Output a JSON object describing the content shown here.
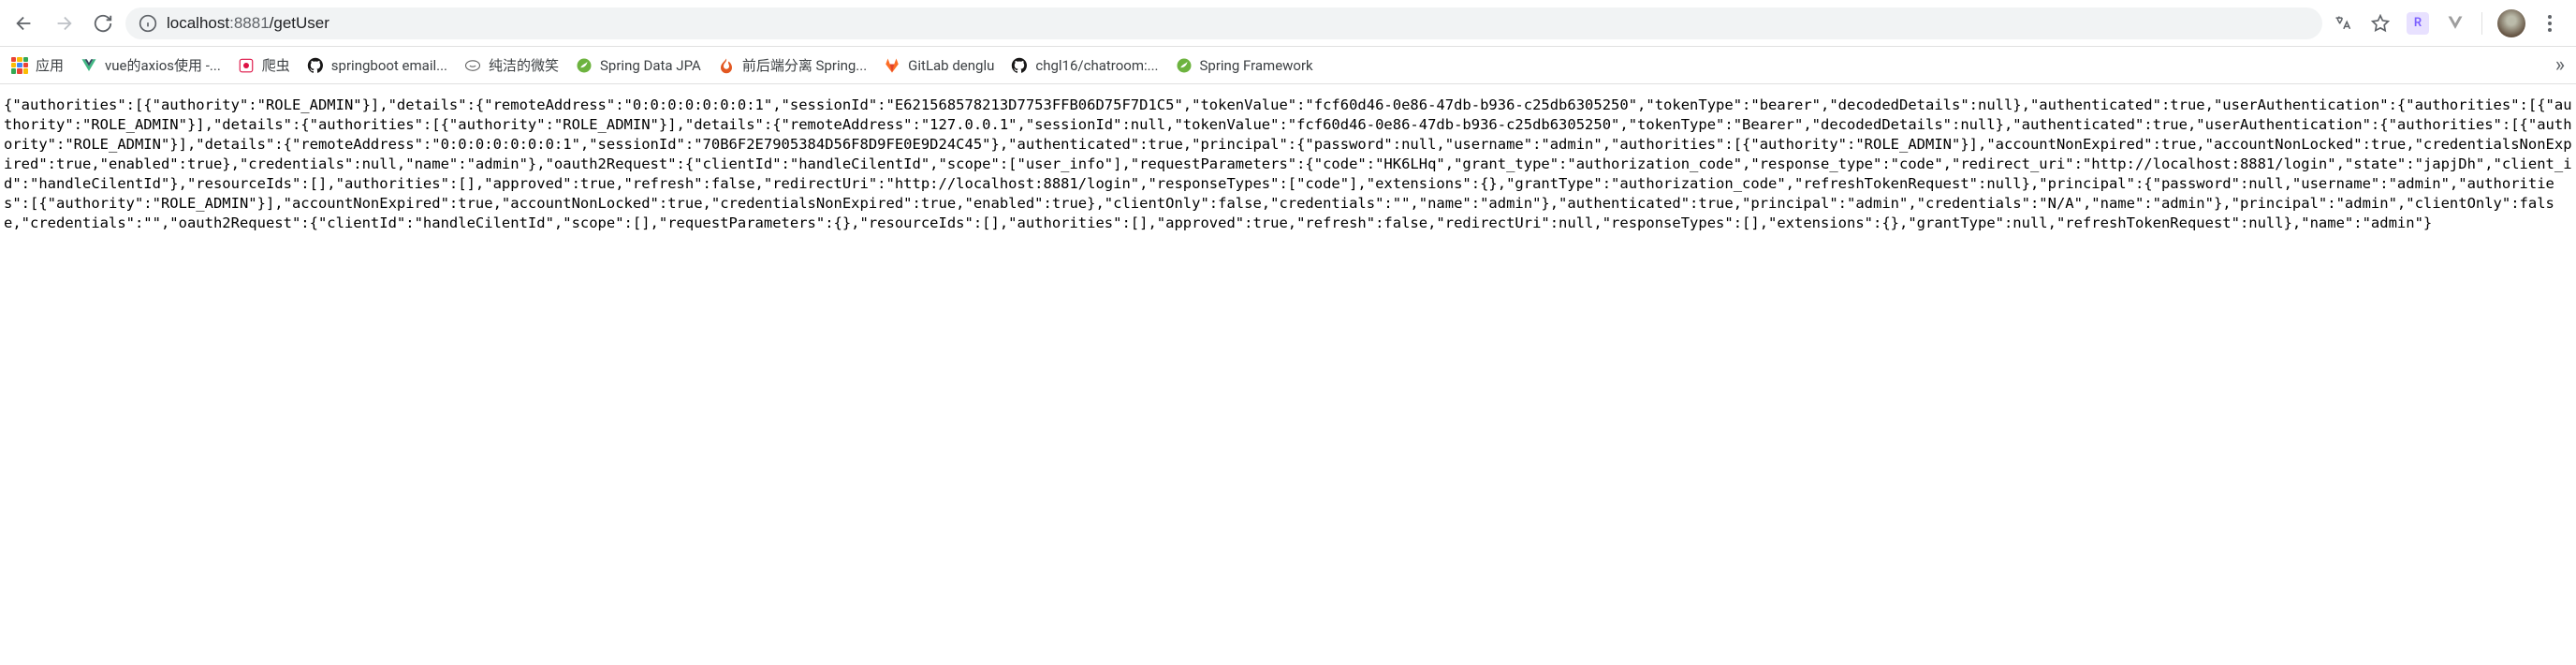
{
  "toolbar": {
    "url_host": "localhost",
    "url_port": ":8881",
    "url_path": "/getUser",
    "ext_r": "R"
  },
  "bookmarks": {
    "apps_label": "应用",
    "items": [
      {
        "label": "vue的axios使用 -...",
        "icon": "vue"
      },
      {
        "label": "爬虫",
        "icon": "crab"
      },
      {
        "label": "springboot email...",
        "icon": "github"
      },
      {
        "label": "纯洁的微笑",
        "icon": "smile"
      },
      {
        "label": "Spring Data JPA",
        "icon": "spring"
      },
      {
        "label": "前后端分离 Spring...",
        "icon": "flame"
      },
      {
        "label": "GitLab denglu",
        "icon": "gitlab"
      },
      {
        "label": "chgl16/chatroom:...",
        "icon": "github"
      },
      {
        "label": "Spring Framework",
        "icon": "spring"
      }
    ],
    "overflow": "»"
  },
  "body_text": "{\"authorities\":[{\"authority\":\"ROLE_ADMIN\"}],\"details\":{\"remoteAddress\":\"0:0:0:0:0:0:0:1\",\"sessionId\":\"E621568578213D7753FFB06D75F7D1C5\",\"tokenValue\":\"fcf60d46-0e86-47db-b936-c25db6305250\",\"tokenType\":\"bearer\",\"decodedDetails\":null},\"authenticated\":true,\"userAuthentication\":{\"authorities\":[{\"authority\":\"ROLE_ADMIN\"}],\"details\":{\"authorities\":[{\"authority\":\"ROLE_ADMIN\"}],\"details\":{\"remoteAddress\":\"127.0.0.1\",\"sessionId\":null,\"tokenValue\":\"fcf60d46-0e86-47db-b936-c25db6305250\",\"tokenType\":\"Bearer\",\"decodedDetails\":null},\"authenticated\":true,\"userAuthentication\":{\"authorities\":[{\"authority\":\"ROLE_ADMIN\"}],\"details\":{\"remoteAddress\":\"0:0:0:0:0:0:0:1\",\"sessionId\":\"70B6F2E7905384D56F8D9FE0E9D24C45\"},\"authenticated\":true,\"principal\":{\"password\":null,\"username\":\"admin\",\"authorities\":[{\"authority\":\"ROLE_ADMIN\"}],\"accountNonExpired\":true,\"accountNonLocked\":true,\"credentialsNonExpired\":true,\"enabled\":true},\"credentials\":null,\"name\":\"admin\"},\"oauth2Request\":{\"clientId\":\"handleCilentId\",\"scope\":[\"user_info\"],\"requestParameters\":{\"code\":\"HK6LHq\",\"grant_type\":\"authorization_code\",\"response_type\":\"code\",\"redirect_uri\":\"http://localhost:8881/login\",\"state\":\"japjDh\",\"client_id\":\"handleCilentId\"},\"resourceIds\":[],\"authorities\":[],\"approved\":true,\"refresh\":false,\"redirectUri\":\"http://localhost:8881/login\",\"responseTypes\":[\"code\"],\"extensions\":{},\"grantType\":\"authorization_code\",\"refreshTokenRequest\":null},\"principal\":{\"password\":null,\"username\":\"admin\",\"authorities\":[{\"authority\":\"ROLE_ADMIN\"}],\"accountNonExpired\":true,\"accountNonLocked\":true,\"credentialsNonExpired\":true,\"enabled\":true},\"clientOnly\":false,\"credentials\":\"\",\"name\":\"admin\"},\"authenticated\":true,\"principal\":\"admin\",\"credentials\":\"N/A\",\"name\":\"admin\"},\"principal\":\"admin\",\"clientOnly\":false,\"credentials\":\"\",\"oauth2Request\":{\"clientId\":\"handleCilentId\",\"scope\":[],\"requestParameters\":{},\"resourceIds\":[],\"authorities\":[],\"approved\":true,\"refresh\":false,\"redirectUri\":null,\"responseTypes\":[],\"extensions\":{},\"grantType\":null,\"refreshTokenRequest\":null},\"name\":\"admin\"}"
}
